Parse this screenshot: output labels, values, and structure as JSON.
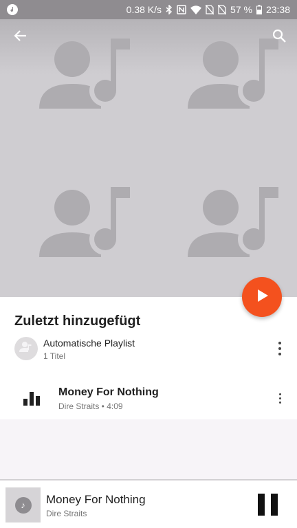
{
  "status_bar": {
    "net_speed": "0.38 K/s",
    "battery": "57 %",
    "time": "23:38"
  },
  "playlist": {
    "title": "Zuletzt hinzugefügt",
    "type_label": "Automatische Playlist",
    "count_label": "1 Titel"
  },
  "tracks": [
    {
      "title": "Money For Nothing",
      "subtitle": "Dire Straits • 4:09"
    }
  ],
  "now_playing": {
    "title": "Money For Nothing",
    "artist": "Dire Straits"
  },
  "colors": {
    "accent": "#f4511e",
    "art_background": "#cfcdd1",
    "status_bar": "#8f8c90"
  }
}
